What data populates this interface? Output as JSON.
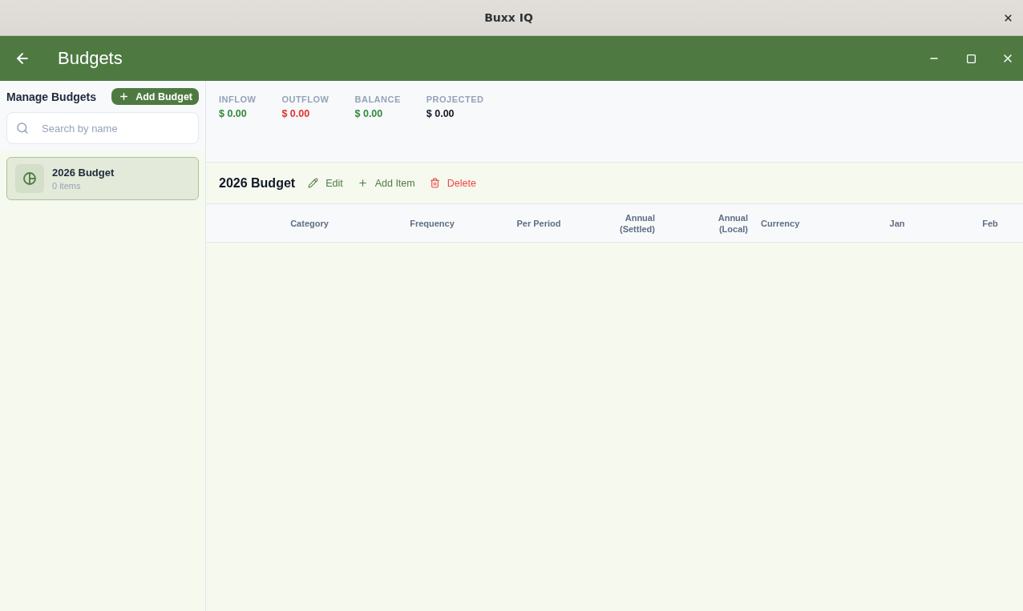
{
  "window": {
    "title": "Buxx IQ"
  },
  "app_bar": {
    "title": "Budgets"
  },
  "sidebar": {
    "heading": "Manage Budgets",
    "add_button": "Add Budget",
    "search": {
      "placeholder": "Search by name"
    },
    "budgets": [
      {
        "name": "2026 Budget",
        "count": "0 items",
        "selected": true
      }
    ]
  },
  "summary": [
    {
      "label": "INFLOW",
      "value": "$ 0.00",
      "color": "#2f8a3b"
    },
    {
      "label": "OUTFLOW",
      "value": "$ 0.00",
      "color": "#e03131"
    },
    {
      "label": "BALANCE",
      "value": "$ 0.00",
      "color": "#2f8a3b"
    },
    {
      "label": "PROJECTED",
      "value": "$ 0.00",
      "color": "#111827"
    }
  ],
  "budget": {
    "title": "2026 Budget",
    "actions": [
      {
        "kind": "edit",
        "label": "Edit"
      },
      {
        "kind": "add",
        "label": "Add Item"
      },
      {
        "kind": "delete",
        "label": "Delete"
      }
    ]
  },
  "table": {
    "columns": [
      "Category",
      "Frequency",
      "Per Period",
      "Annual (Settled)",
      "Annual (Local)",
      "Currency",
      "Jan",
      "Feb"
    ]
  }
}
